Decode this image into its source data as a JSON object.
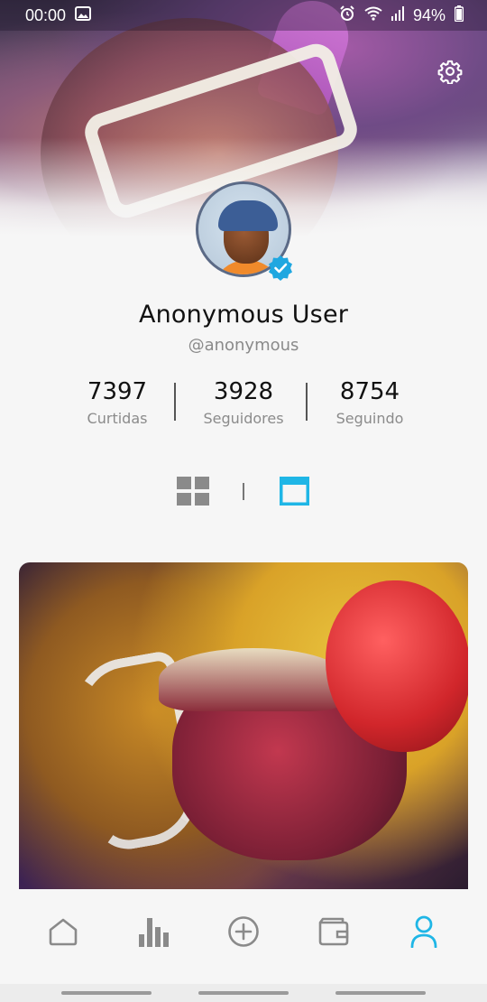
{
  "status_bar": {
    "time": "00:00",
    "battery": "94%"
  },
  "profile": {
    "name": "Anonymous User",
    "handle": "@anonymous",
    "verified": true
  },
  "stats": [
    {
      "value": "7397",
      "label": "Curtidas"
    },
    {
      "value": "3928",
      "label": "Seguidores"
    },
    {
      "value": "8754",
      "label": "Seguindo"
    }
  ],
  "view_toggle": {
    "selected": "feed"
  },
  "bottom_nav": {
    "items": [
      "home-icon",
      "chart-bar-icon",
      "add-circle-icon",
      "wallet-icon",
      "profile-icon"
    ],
    "active": "profile"
  },
  "colors": {
    "accent": "#1fb6e6",
    "icon_inactive": "#8a8a8a",
    "background": "#f6f6f6"
  }
}
